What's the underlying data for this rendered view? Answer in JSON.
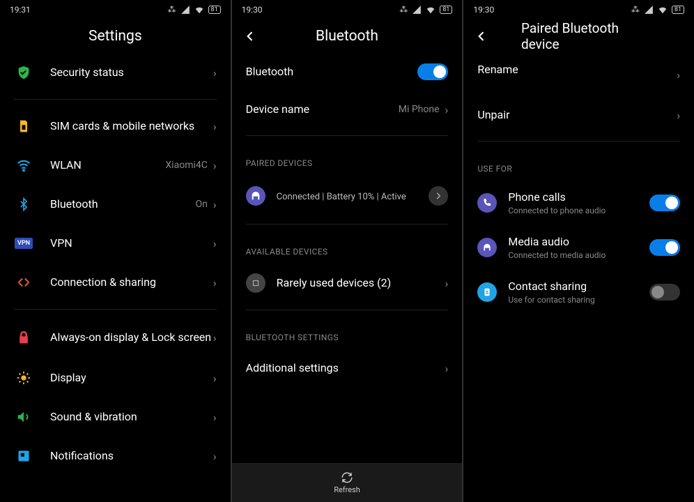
{
  "status": {
    "time1": "19:31",
    "time2": "19:30",
    "time3": "19:30",
    "battery": "81"
  },
  "screen1": {
    "title": "Settings",
    "items": [
      {
        "label": "Security status"
      },
      {
        "label": "SIM cards & mobile networks"
      },
      {
        "label": "WLAN",
        "value": "Xiaomi4C"
      },
      {
        "label": "Bluetooth",
        "value": "On"
      },
      {
        "label": "VPN"
      },
      {
        "label": "Connection & sharing"
      },
      {
        "label": "Always-on display & Lock screen"
      },
      {
        "label": "Display"
      },
      {
        "label": "Sound & vibration"
      },
      {
        "label": "Notifications"
      }
    ]
  },
  "screen2": {
    "title": "Bluetooth",
    "bt_label": "Bluetooth",
    "device_name_label": "Device name",
    "device_name_value": "Mi Phone",
    "sec_paired": "PAIRED DEVICES",
    "paired_status": "Connected | Battery 10% | Active",
    "sec_available": "AVAILABLE DEVICES",
    "rarely": "Rarely used devices (2)",
    "sec_settings": "BLUETOOTH SETTINGS",
    "additional": "Additional settings",
    "refresh": "Refresh"
  },
  "screen3": {
    "title": "Paired Bluetooth device",
    "rename": "Rename",
    "unpair": "Unpair",
    "sec_usefor": "USE FOR",
    "usefor": [
      {
        "label": "Phone calls",
        "sub": "Connected to phone audio",
        "on": true
      },
      {
        "label": "Media audio",
        "sub": "Connected to media audio",
        "on": true
      },
      {
        "label": "Contact sharing",
        "sub": "Use for contact sharing",
        "on": false
      }
    ]
  }
}
